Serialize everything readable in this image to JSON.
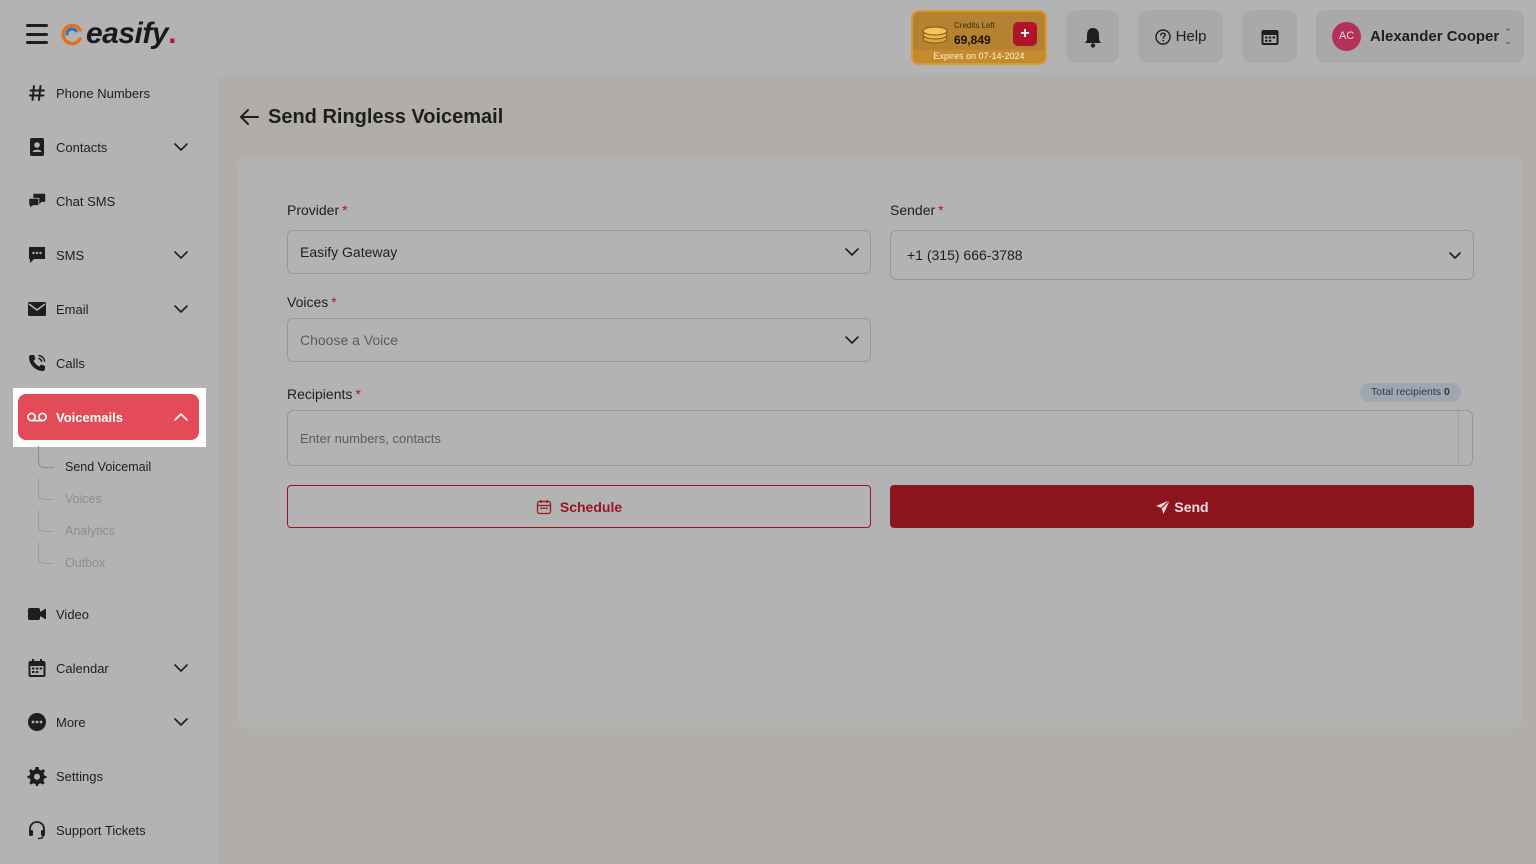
{
  "header": {
    "logo_text": "easify",
    "logo_dot": ".",
    "credits": {
      "label": "Credits Left",
      "value": "69,849",
      "add_label": "+",
      "expiry": "Expires on 07-14-2024"
    },
    "help_label": "Help",
    "user": {
      "initials": "AC",
      "name": "Alexander Cooper"
    }
  },
  "sidebar": {
    "items": [
      {
        "label": "Phone Numbers",
        "icon": "hash-icon"
      },
      {
        "label": "Contacts",
        "icon": "contacts-icon"
      },
      {
        "label": "Chat SMS",
        "icon": "chat-icon"
      },
      {
        "label": "SMS",
        "icon": "sms-icon"
      },
      {
        "label": "Email",
        "icon": "email-icon"
      },
      {
        "label": "Calls",
        "icon": "phone-icon"
      },
      {
        "label": "Voicemails",
        "icon": "voicemail-icon",
        "active": true
      },
      {
        "label": "Video",
        "icon": "video-icon"
      },
      {
        "label": "Calendar",
        "icon": "calendar-icon"
      },
      {
        "label": "More",
        "icon": "more-icon"
      },
      {
        "label": "Settings",
        "icon": "gear-icon"
      },
      {
        "label": "Support Tickets",
        "icon": "headset-icon"
      }
    ],
    "voicemail_sub": [
      {
        "label": "Send Voicemail",
        "selected": true
      },
      {
        "label": "Voices"
      },
      {
        "label": "Analytics"
      },
      {
        "label": "Outbox"
      }
    ]
  },
  "page": {
    "title": "Send Ringless Voicemail"
  },
  "form": {
    "provider": {
      "label": "Provider",
      "required": "*",
      "value": "Easify Gateway"
    },
    "sender": {
      "label": "Sender",
      "required": "*",
      "value": "+1 (315) 666-3788"
    },
    "voices": {
      "label": "Voices",
      "required": "*",
      "placeholder": "Choose a Voice"
    },
    "recipients": {
      "label": "Recipients",
      "required": "*",
      "placeholder": "Enter numbers, contacts",
      "total_label": "Total recipients",
      "total_value": "0"
    },
    "schedule_label": "Schedule",
    "send_label": "Send"
  },
  "colors": {
    "brand_red": "#9a1422",
    "active_nav": "#e34b58",
    "credits_gold": "#c48a2c"
  }
}
